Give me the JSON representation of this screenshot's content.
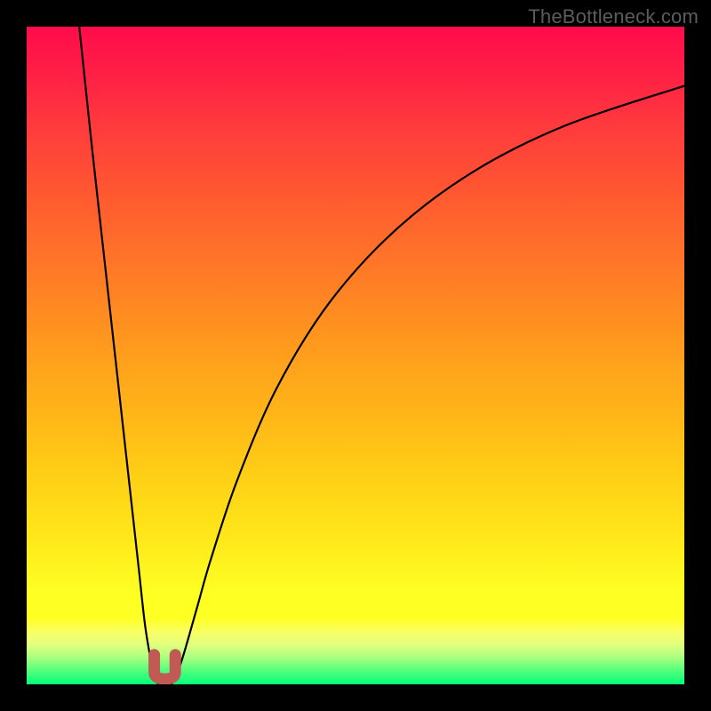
{
  "watermark": "TheBottleneck.com",
  "chart_data": {
    "type": "line",
    "title": "",
    "xlabel": "",
    "ylabel": "",
    "xlim": [
      0,
      100
    ],
    "ylim": [
      0,
      100
    ],
    "grid": false,
    "series": [
      {
        "name": "left-branch",
        "x": [
          8,
          10,
          12,
          14,
          16,
          17,
          18,
          19,
          19.5,
          20
        ],
        "y": [
          100,
          81,
          63,
          45,
          27,
          18,
          9,
          3,
          1,
          0
        ]
      },
      {
        "name": "right-branch",
        "x": [
          22,
          23,
          24,
          26,
          28,
          32,
          38,
          46,
          56,
          68,
          82,
          100
        ],
        "y": [
          0,
          2,
          5,
          12,
          19,
          31,
          45,
          58,
          69,
          78,
          85,
          91
        ]
      }
    ],
    "marker": {
      "name": "notch-marker",
      "x_center": 21,
      "width_x": 3.2,
      "height_y": 4.5,
      "color": "#c15a54"
    },
    "colors": {
      "curve": "#000000",
      "background_frame": "#000000",
      "marker": "#c15a54"
    }
  }
}
